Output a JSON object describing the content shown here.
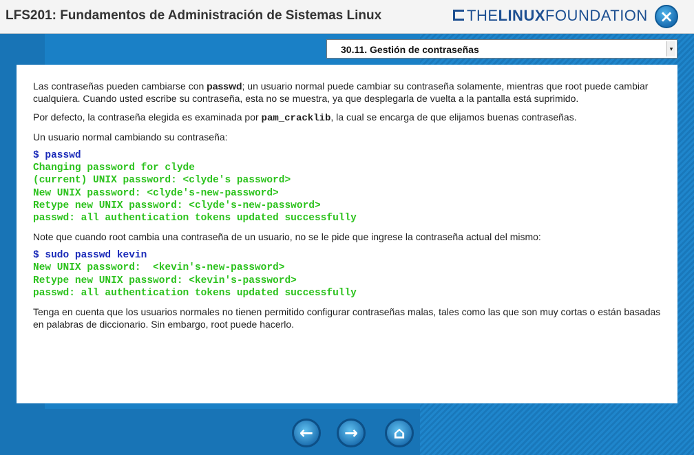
{
  "header": {
    "title": "LFS201: Fundamentos de Administración de Sistemas Linux",
    "logo_pre": "THE",
    "logo_bold": "LINUX",
    "logo_post": " FOUNDATION",
    "close_icon": "×"
  },
  "chapter_select": {
    "selected": "30.11. Gestión de contraseñas",
    "arrow": "▾"
  },
  "content": {
    "p1_a": "Las contraseñas pueden cambiarse con ",
    "p1_bold": "passwd",
    "p1_b": "; un usuario normal puede cambiar su contraseña solamente, mientras que root puede cambiar cualquiera. Cuando usted escribe su contraseña, esta no se muestra, ya que desplegarla de vuelta a la pantalla está suprimido.",
    "p2_a": "Por defecto, la contraseña elegida es examinada por ",
    "p2_code": "pam_cracklib",
    "p2_b": ", la cual se encarga de que elijamos buenas contraseñas.",
    "p3": "Un usuario normal cambiando su contraseña:",
    "code1_cmd": "$ passwd",
    "code1_out": "Changing password for clyde\n(current) UNIX password: <clyde's password>\nNew UNIX password: <clyde's-new-password>\nRetype new UNIX password: <clyde's-new-password>\npasswd: all authentication tokens updated successfully",
    "p4": "Note que cuando root cambia una contraseña de un usuario, no se le pide que ingrese la contraseña actual del mismo:",
    "code2_cmd": "$ sudo passwd kevin",
    "code2_out": "New UNIX password:  <kevin's-new-password>\nRetype new UNIX password: <kevin's-password>\npasswd: all authentication tokens updated successfully",
    "p5": "Tenga en cuenta que los usuarios normales no tienen permitido configurar contraseñas malas, tales como las que son muy cortas o están basadas en palabras de diccionario. Sin embargo, root puede hacerlo."
  },
  "nav": {
    "back_icon": "arrow-left-icon",
    "forward_icon": "arrow-right-icon",
    "home_icon": "home-icon"
  },
  "colors": {
    "command": "#1a2ab8",
    "output": "#2cc21d",
    "background": "#1a7fc4"
  }
}
